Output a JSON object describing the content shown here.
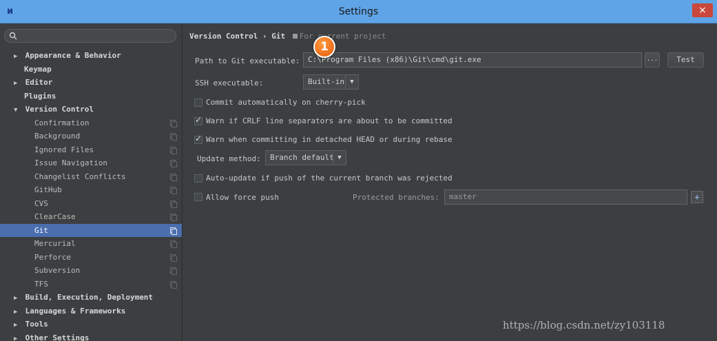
{
  "window": {
    "title": "Settings",
    "app_icon": "intellij-icon",
    "close_label": "×"
  },
  "sidebar": {
    "search_placeholder": "",
    "items": [
      {
        "label": "Appearance & Behavior",
        "level": 0,
        "arrow": "▶"
      },
      {
        "label": "Keymap",
        "level": 0,
        "arrow": ""
      },
      {
        "label": "Editor",
        "level": 0,
        "arrow": "▶"
      },
      {
        "label": "Plugins",
        "level": 0,
        "arrow": ""
      },
      {
        "label": "Version Control",
        "level": 0,
        "arrow": "▼"
      },
      {
        "label": "Confirmation",
        "level": 1
      },
      {
        "label": "Background",
        "level": 1
      },
      {
        "label": "Ignored Files",
        "level": 1
      },
      {
        "label": "Issue Navigation",
        "level": 1
      },
      {
        "label": "Changelist Conflicts",
        "level": 1
      },
      {
        "label": "GitHub",
        "level": 1
      },
      {
        "label": "CVS",
        "level": 1
      },
      {
        "label": "ClearCase",
        "level": 1
      },
      {
        "label": "Git",
        "level": 1,
        "selected": true
      },
      {
        "label": "Mercurial",
        "level": 1
      },
      {
        "label": "Perforce",
        "level": 1
      },
      {
        "label": "Subversion",
        "level": 1
      },
      {
        "label": "TFS",
        "level": 1
      },
      {
        "label": "Build, Execution, Deployment",
        "level": 0,
        "arrow": "▶"
      },
      {
        "label": "Languages & Frameworks",
        "level": 0,
        "arrow": "▶"
      },
      {
        "label": "Tools",
        "level": 0,
        "arrow": "▶"
      },
      {
        "label": "Other Settings",
        "level": 0,
        "arrow": "▶"
      }
    ]
  },
  "breadcrumb": {
    "path": "Version Control › Git",
    "scope": "For current project"
  },
  "git": {
    "path_label": "Path to Git executable:",
    "path_value": "C:\\Program Files (x86)\\Git\\cmd\\git.exe",
    "browse_label": "...",
    "test_label": "Test",
    "ssh_label": "SSH executable:",
    "ssh_value": "Built-in",
    "cherry_pick_label": "Commit automatically on cherry-pick",
    "cherry_pick_checked": false,
    "crlf_label": "Warn if CRLF line separators are about to be committed",
    "crlf_checked": true,
    "detached_label": "Warn when committing in detached HEAD or during rebase",
    "detached_checked": true,
    "update_label": "Update method:",
    "update_value": "Branch default",
    "autoupdate_label": "Auto-update if push of the current branch was rejected",
    "autoupdate_checked": false,
    "force_push_label": "Allow force push",
    "force_push_checked": false,
    "protected_label": "Protected branches:",
    "protected_value": "master"
  },
  "annotation": {
    "badge": "1"
  },
  "watermark": "https://blog.csdn.net/zy103118"
}
